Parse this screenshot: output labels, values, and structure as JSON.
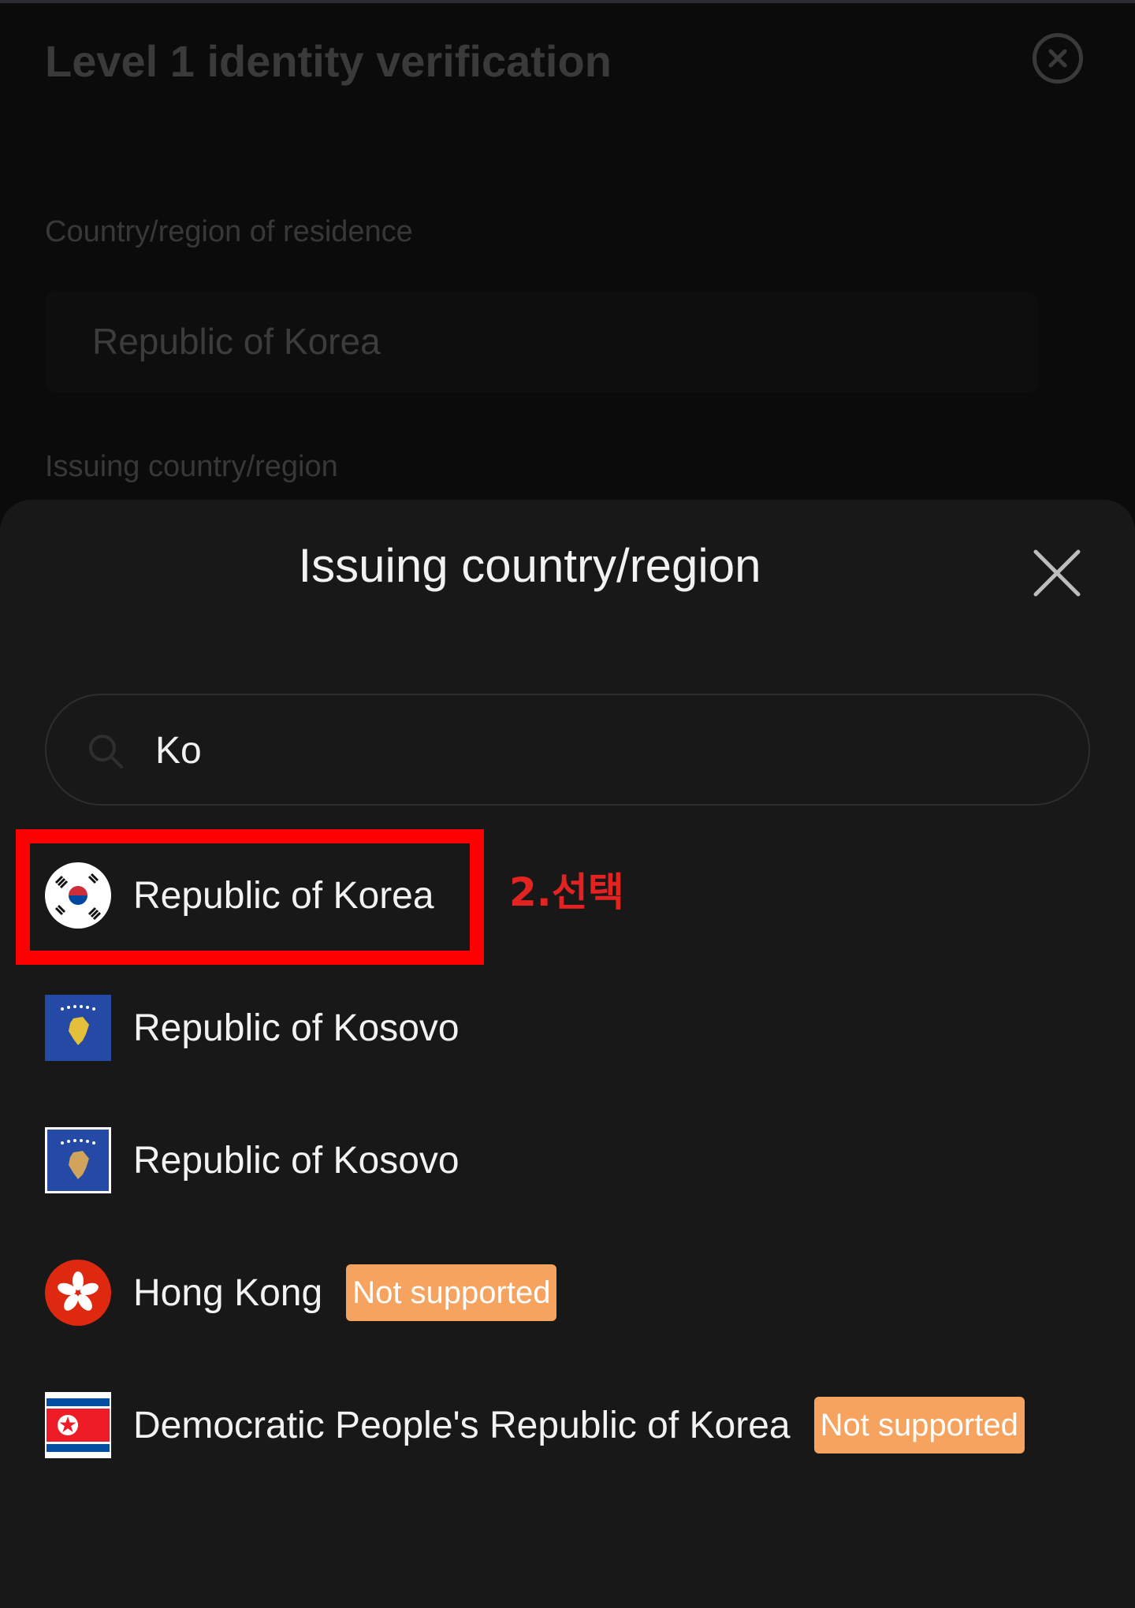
{
  "background_page": {
    "title": "Level 1 identity verification",
    "residence_label": "Country/region of residence",
    "residence_value": "Republic of Korea",
    "issuing_label": "Issuing country/region"
  },
  "sheet": {
    "title": "Issuing country/region",
    "search": {
      "value": "Ko"
    },
    "results": [
      {
        "name": "Republic of Korea",
        "flag": "south-korea-flag-icon",
        "badge": ""
      },
      {
        "name": "Republic of Kosovo",
        "flag": "kosovo-flag-icon",
        "badge": ""
      },
      {
        "name": "Republic of Kosovo",
        "flag": "kosovo-flag-icon",
        "badge": ""
      },
      {
        "name": "Hong Kong",
        "flag": "hong-kong-flag-icon",
        "badge": "Not supported"
      },
      {
        "name": "Democratic People's Republic of Korea",
        "flag": "north-korea-flag-icon",
        "badge": "Not supported"
      }
    ]
  },
  "annotation": {
    "step_label": "2.선택",
    "color": "#ff0000"
  },
  "colors": {
    "sheet_background": "#181818",
    "badge_background": "#f6a35f",
    "text": "#f2f2f2"
  }
}
